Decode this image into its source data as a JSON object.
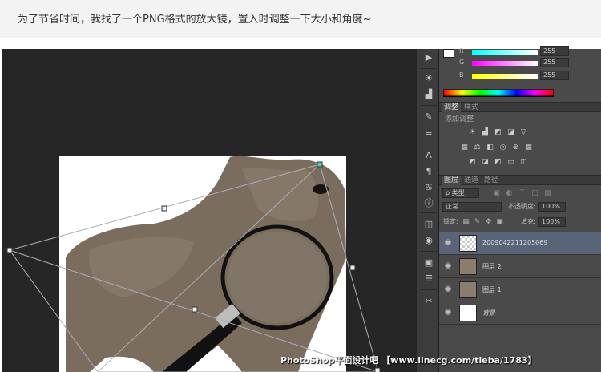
{
  "caption": "为了节省时间，我找了一个PNG格式的放大镜，置入时调整一下大小和角度~",
  "colors": {
    "workspace": "#262626",
    "panel": "#4a4a4a",
    "toolstrip": "#3c3c3c",
    "selected_layer": "#5a6478",
    "transform_line": "#a8b0b8",
    "transform_handle": "#4fd0b8"
  },
  "toolstrip": {
    "icons": [
      "play-icon",
      "sun-icon",
      "histogram-icon",
      "brush-icon",
      "adjust-icon",
      "text-icon",
      "paragraph-icon",
      "glyphs-icon",
      "info-icon",
      "layers-comp-icon",
      "eye-icon",
      "navigator-icon",
      "notes-icon",
      "scissors-icon"
    ]
  },
  "color_panel": {
    "channels": [
      {
        "letter": "R",
        "value": "255",
        "gradient_colors": [
          "#00ffff",
          "#ffffff"
        ]
      },
      {
        "letter": "G",
        "value": "255",
        "gradient_colors": [
          "#ff00ff",
          "#ffffff"
        ]
      },
      {
        "letter": "B",
        "value": "255",
        "gradient_colors": [
          "#ffff00",
          "#ffffff"
        ]
      }
    ]
  },
  "adjustments": {
    "tabs": [
      "调整",
      "样式"
    ],
    "title": "添加调整"
  },
  "layers": {
    "tabs": [
      "图层",
      "通道",
      "路径"
    ],
    "kind_filter": "ρ 类型",
    "blend_mode": "正常",
    "opacity_label": "不透明度:",
    "opacity_value": "100%",
    "lock_label": "锁定:",
    "fill_label": "填充:",
    "fill_value": "100%",
    "items": [
      {
        "name": "2009042211205069",
        "thumb": "magnifier",
        "selected": true
      },
      {
        "name": "图层 2",
        "thumb": "donkey",
        "selected": false
      },
      {
        "name": "图层 1",
        "thumb": "donkey",
        "selected": false
      },
      {
        "name": "背景",
        "thumb": "white",
        "selected": false
      }
    ]
  },
  "watermark": "PhotoShop平面设计吧 【www.linecg.com/tieba/1783】"
}
